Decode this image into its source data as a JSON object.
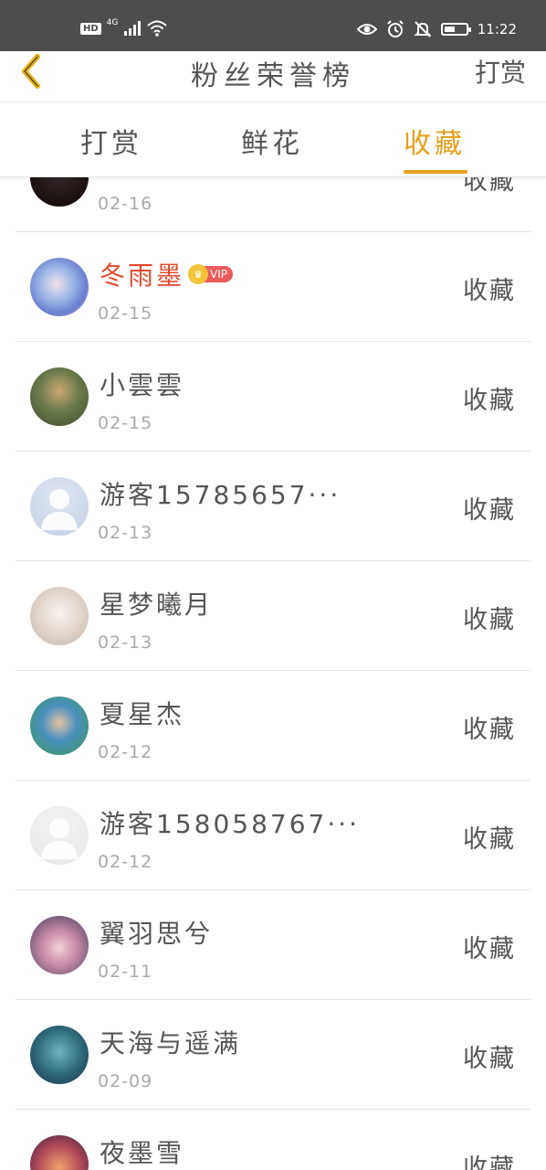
{
  "status_bar": {
    "hd": "HD",
    "network": "4G",
    "time": "11:22",
    "battery_level": 0.5,
    "icons": [
      "signal-icon",
      "wifi-icon",
      "eye-icon",
      "alarm-icon",
      "bell-off-icon",
      "battery-icon"
    ]
  },
  "header": {
    "title": "粉丝荣誉榜",
    "right_action": "打赏",
    "back_icon": "chevron-left-icon",
    "back_color": "#e8b11a"
  },
  "tabs": [
    {
      "label": "打赏",
      "active": false
    },
    {
      "label": "鲜花",
      "active": false
    },
    {
      "label": "收藏",
      "active": true
    }
  ],
  "accent_color": "#e89f1b",
  "list": [
    {
      "name": "",
      "date": "02-16",
      "action": "收藏",
      "vip": false,
      "avatar": "dark-text-avatar"
    },
    {
      "name": "冬雨墨",
      "date": "02-15",
      "action": "收藏",
      "vip": true,
      "vip_label": "VIP",
      "avatar": "anime-blue-hair-avatar"
    },
    {
      "name": "小雲雲",
      "date": "02-15",
      "action": "收藏",
      "vip": false,
      "avatar": "anime-green-avatar"
    },
    {
      "name": "游客15785657···",
      "date": "02-13",
      "action": "收藏",
      "vip": false,
      "avatar": "default-user-avatar"
    },
    {
      "name": "星梦曦月",
      "date": "02-13",
      "action": "收藏",
      "vip": false,
      "avatar": "anime-white-hair-avatar"
    },
    {
      "name": "夏星杰",
      "date": "02-12",
      "action": "收藏",
      "vip": false,
      "avatar": "kids-photo-avatar"
    },
    {
      "name": "游客158058767···",
      "date": "02-12",
      "action": "收藏",
      "vip": false,
      "avatar": "default-user-avatar-light"
    },
    {
      "name": "翼羽思兮",
      "date": "02-11",
      "action": "收藏",
      "vip": false,
      "avatar": "anime-blossom-avatar"
    },
    {
      "name": "天海与遥满",
      "date": "02-09",
      "action": "收藏",
      "vip": false,
      "avatar": "anime-sailor-avatar"
    },
    {
      "name": "夜墨雪",
      "date": "",
      "action": "收藏",
      "vip": false,
      "avatar": "anime-sunset-avatar"
    }
  ]
}
